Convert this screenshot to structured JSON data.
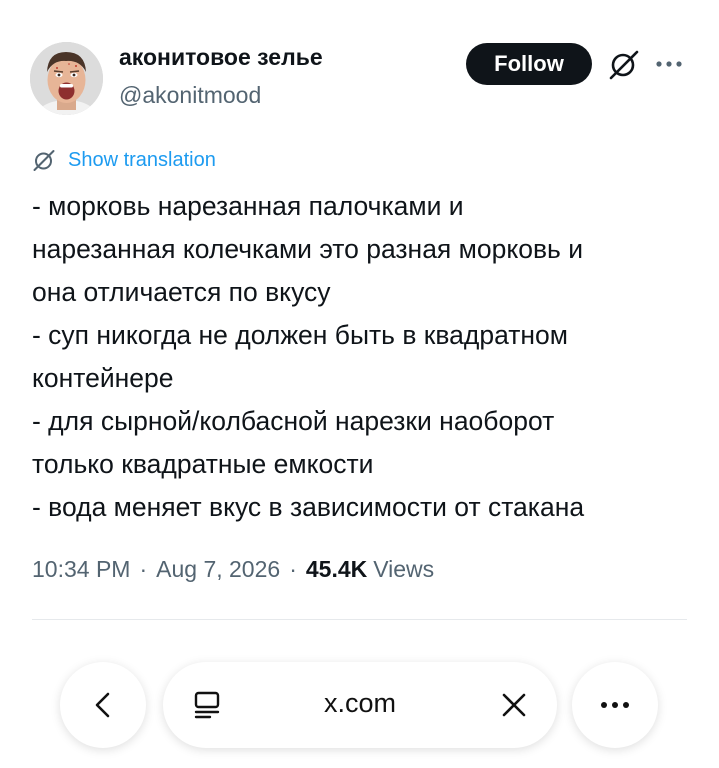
{
  "tweet": {
    "display_name": "аконитовое зелье",
    "handle": "@akonitmood",
    "follow_label": "Follow",
    "translate_label": "Show translation",
    "text_lines": [
      "- морковь нарезанная палочками и",
      "нарезанная колечками это разная морковь и",
      "она отличается по вкусу",
      "- суп никогда не должен быть в квадратном",
      "контейнере",
      "- для сырной/колбасной нарезки наоборот",
      "только квадратные емкости",
      "- вода меняет вкус в зависимости от стакана"
    ],
    "time": "10:34 PM",
    "date": "Aug 7, 2026",
    "separator": "·",
    "views_count": "45.4K",
    "views_label": "Views"
  },
  "browser": {
    "url": "x.com"
  },
  "icons": {
    "grok": "grok-icon",
    "more": "more-horizontal-icon",
    "back": "chevron-left-icon",
    "reader": "reader-mode-icon",
    "close": "close-icon",
    "menu": "more-horizontal-icon"
  },
  "colors": {
    "text": "#0f1419",
    "secondary": "#536471",
    "link": "#1d9bf0",
    "follow_bg": "#0f1419",
    "follow_text": "#ffffff"
  }
}
